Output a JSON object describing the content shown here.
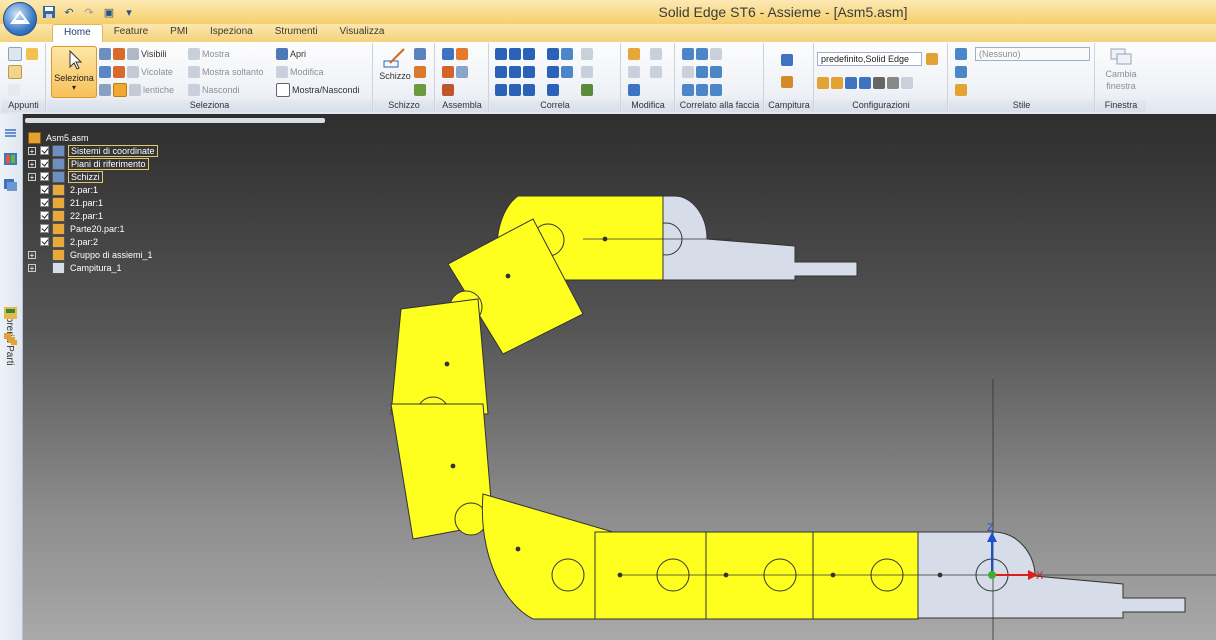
{
  "window": {
    "title": "Solid Edge ST6 - Assieme - [Asm5.asm]"
  },
  "tabs": [
    {
      "label": "Home",
      "active": true
    },
    {
      "label": "Feature"
    },
    {
      "label": "PMI"
    },
    {
      "label": "Ispeziona"
    },
    {
      "label": "Strumenti"
    },
    {
      "label": "Visualizza"
    }
  ],
  "ribbon": {
    "appunti": {
      "label": "Appunti"
    },
    "seleziona": {
      "label": "Seleziona",
      "big_button": "Seleziona",
      "visibili": "Visibili",
      "vicolate": "Vicolate",
      "lentiche": "lentiche",
      "mostra": "Mostra",
      "mostra_soltanto": "Mostra soltanto",
      "nascondi": "Nascondi",
      "apri": "Apri",
      "modifica": "Modifica",
      "mostra_nascondi": "Mostra/Nascondi"
    },
    "schizzo": {
      "label": "Schizzo",
      "big_button": "Schizzo"
    },
    "assembla": {
      "label": "Assembla"
    },
    "correla": {
      "label": "Correla"
    },
    "modifica": {
      "label": "Modifica"
    },
    "correlato": {
      "label": "Correlato alla faccia"
    },
    "campitura": {
      "label": "Campitura"
    },
    "configurazioni": {
      "label": "Configurazioni",
      "combo_value": "predefinito,Solid Edge"
    },
    "stile": {
      "label": "Stile",
      "combo_value": "(Nessuno)"
    },
    "finestra": {
      "label": "Finestra",
      "cambia": "Cambia",
      "finestra_btn": "finestra"
    }
  },
  "side_panel": {
    "libreria_label": "Libreria Parti"
  },
  "tree": {
    "root": "Asm5.asm",
    "items": [
      {
        "label": "Sistemi di coordinate",
        "expand": true,
        "check": true,
        "icon": "coordinate-system-icon"
      },
      {
        "label": "Piani di riferimento",
        "expand": true,
        "check": true,
        "icon": "reference-planes-icon"
      },
      {
        "label": "Schizzi",
        "expand": true,
        "check": true,
        "icon": "sketches-icon"
      },
      {
        "label": "2.par:1",
        "expand": false,
        "check": true,
        "icon": "part-icon"
      },
      {
        "label": "21.par:1",
        "expand": false,
        "check": true,
        "icon": "part-icon"
      },
      {
        "label": "22.par:1",
        "expand": false,
        "check": true,
        "icon": "part-icon"
      },
      {
        "label": "Parte20.par:1",
        "expand": false,
        "check": true,
        "icon": "part-icon"
      },
      {
        "label": "2.par:2",
        "expand": false,
        "check": true,
        "icon": "part-icon"
      },
      {
        "label": "Gruppo di assiemi_1",
        "expand": true,
        "check": false,
        "icon": "assembly-group-icon"
      },
      {
        "label": "Campitura_1",
        "expand": true,
        "check": false,
        "icon": "hatch-icon"
      }
    ]
  },
  "triad": {
    "z": "Z",
    "x": "X"
  },
  "colors": {
    "link_yellow": "#ffff1f",
    "end_part": "#d6dde8",
    "background_top": "#2e2e2e",
    "background_bottom": "#a9a9a9"
  }
}
